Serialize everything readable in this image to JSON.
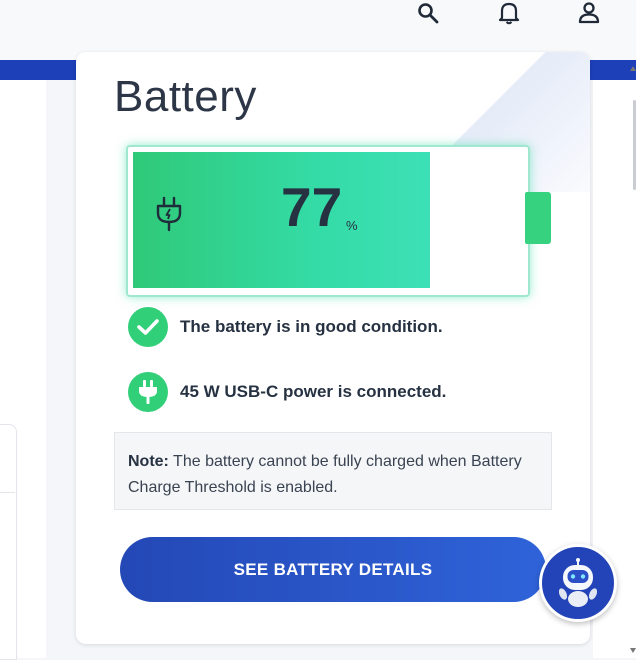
{
  "header": {
    "icons": [
      "search-icon",
      "bell-icon",
      "user-icon"
    ]
  },
  "colors": {
    "accent_blue": "#1d3fb8",
    "battery_green": "#31cf78",
    "battery_teal": "#3de0b6",
    "text_dark": "#263242"
  },
  "battery": {
    "title": "Battery",
    "percent_value": "77",
    "percent_unit": "%",
    "charge_fraction": 0.77,
    "status": [
      {
        "icon": "check-icon",
        "text": "The battery is in good condition."
      },
      {
        "icon": "plug-icon",
        "text": "45 W USB-C power is connected."
      }
    ],
    "note_label": "Note:",
    "note_text": " The battery cannot be fully charged when Battery Charge Threshold is enabled.",
    "details_button": "SEE BATTERY DETAILS"
  },
  "assistant": {
    "icon": "robot-assistant-icon"
  }
}
